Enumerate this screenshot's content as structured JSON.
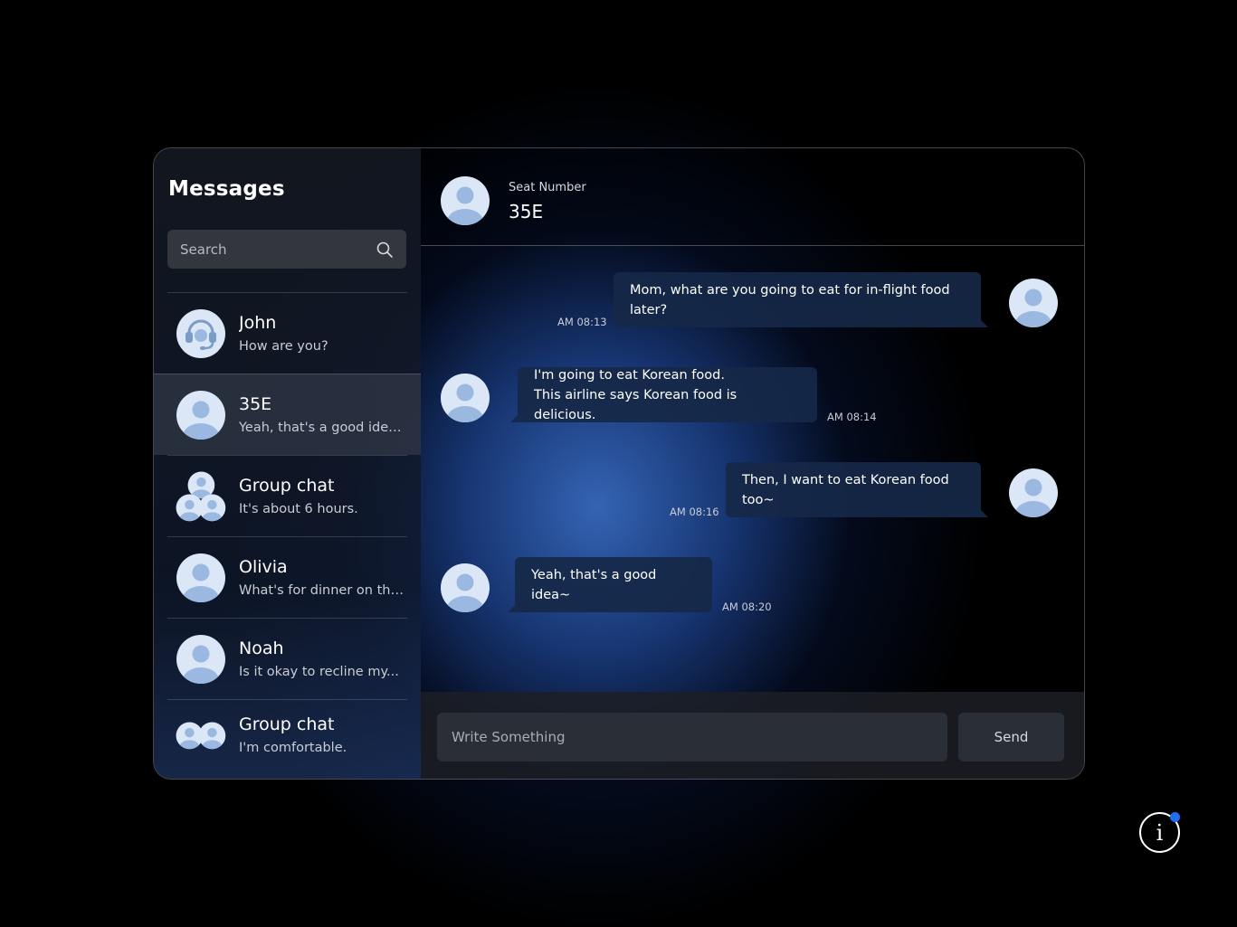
{
  "sidebar": {
    "title": "Messages",
    "search_placeholder": "Search",
    "contacts": [
      {
        "name": "John",
        "preview": "How are you?",
        "avatar": "headset-avatar-icon"
      },
      {
        "name": "35E",
        "preview": "Yeah, that's a good idea~",
        "avatar": "person-avatar-icon",
        "active": true
      },
      {
        "name": "Group chat",
        "preview": "It's about 6 hours.",
        "avatar": "group-avatar-icon"
      },
      {
        "name": "Olivia",
        "preview": "What's for dinner on this...",
        "avatar": "person-avatar-icon"
      },
      {
        "name": "Noah",
        "preview": "Is it okay to recline my...",
        "avatar": "person-avatar-icon"
      },
      {
        "name": "Group chat",
        "preview": "I'm comfortable.",
        "avatar": "pair-avatar-icon"
      }
    ]
  },
  "chat": {
    "header_label": "Seat Number",
    "header_title": "35E",
    "messages": [
      {
        "direction": "out",
        "lines": [
          "Mom, what are you going to eat for in-flight food later?"
        ],
        "time": "AM 08:13"
      },
      {
        "direction": "in",
        "lines": [
          "I'm going to eat Korean food.",
          "This airline says Korean food is delicious."
        ],
        "time": "AM 08:14"
      },
      {
        "direction": "out",
        "lines": [
          "Then, I want to eat Korean food too~"
        ],
        "time": "AM 08:16"
      },
      {
        "direction": "in",
        "lines": [
          "Yeah, that's a good idea~"
        ],
        "time": "AM 08:20"
      }
    ],
    "composer_placeholder": "Write Something",
    "send_label": "Send"
  },
  "info_button": {
    "icon": "info-icon",
    "badge_color": "#1e6ff0"
  },
  "colors": {
    "avatar_fill": "#dbe7f7",
    "avatar_figure": "#9ab8e0",
    "bubble": "#16284a"
  }
}
